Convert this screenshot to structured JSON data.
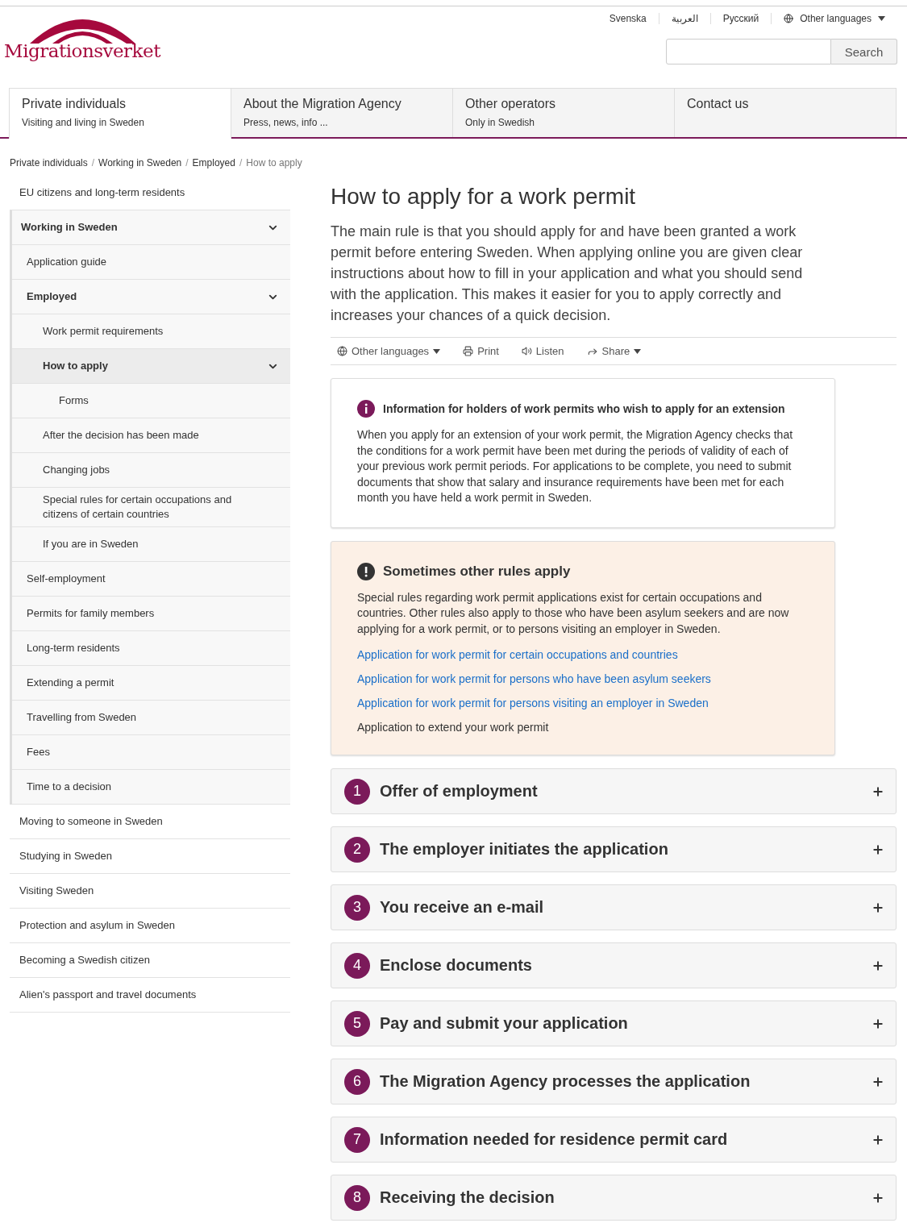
{
  "header": {
    "logo_text": "Migrationsverket",
    "languages": [
      {
        "label": "Svenska",
        "kind": "text"
      },
      {
        "label": "العربية",
        "kind": "text"
      },
      {
        "label": "Русский",
        "kind": "text"
      },
      {
        "label": "Other languages",
        "kind": "menu"
      }
    ],
    "search": {
      "button": "Search"
    }
  },
  "nav": [
    {
      "title": "Private individuals",
      "subtitle": "Visiting and living in Sweden",
      "selected": true
    },
    {
      "title": "About the Migration Agency",
      "subtitle": "Press, news, info ...",
      "selected": false
    },
    {
      "title": "Other operators",
      "subtitle": "Only in Swedish",
      "selected": false
    },
    {
      "title": "Contact us",
      "selected": false
    }
  ],
  "breadcrumb_separator": "/",
  "breadcrumb": [
    {
      "label": "Private individuals",
      "current": false
    },
    {
      "label": "Working in Sweden",
      "current": false
    },
    {
      "label": "Employed",
      "current": false
    },
    {
      "label": "How to apply",
      "current": true
    }
  ],
  "sidebar": {
    "items": [
      {
        "label": "EU citizens and long-term residents",
        "selected": false
      },
      {
        "label": "Working in Sweden",
        "selected": false,
        "expanded": true,
        "children": [
          {
            "label": "Application guide",
            "selected": false
          },
          {
            "label": "Employed",
            "selected": false,
            "expanded": true,
            "children": [
              {
                "label": "Work permit requirements",
                "selected": false
              },
              {
                "label": "How to apply",
                "selected": true,
                "expanded": true,
                "children": [
                  {
                    "label": "Forms",
                    "selected": false
                  }
                ]
              },
              {
                "label": "After the decision has been made",
                "selected": false
              },
              {
                "label": "Changing jobs",
                "selected": false
              },
              {
                "label": "Special rules for certain occupations and citizens of certain countries",
                "selected": false
              },
              {
                "label": "If you are in Sweden",
                "selected": false
              }
            ]
          },
          {
            "label": "Self-employment",
            "selected": false
          },
          {
            "label": "Permits for family members",
            "selected": false
          },
          {
            "label": "Long-term residents",
            "selected": false
          },
          {
            "label": "Extending a permit",
            "selected": false
          },
          {
            "label": "Travelling from Sweden",
            "selected": false
          },
          {
            "label": "Fees",
            "selected": false
          },
          {
            "label": "Time to a decision",
            "selected": false
          }
        ]
      },
      {
        "label": "Moving to someone in Sweden",
        "selected": false
      },
      {
        "label": "Studying in Sweden",
        "selected": false
      },
      {
        "label": "Visiting Sweden",
        "selected": false
      },
      {
        "label": "Protection and asylum in Sweden",
        "selected": false
      },
      {
        "label": "Becoming a Swedish citizen",
        "selected": false
      },
      {
        "label": "Alien's passport and travel documents",
        "selected": false
      }
    ]
  },
  "main": {
    "title": "How to apply for a work permit",
    "intro": "The main rule is that you should apply for and have been granted a work permit before entering Sweden. When applying online you are given clear instructions about how to fill in your application and what you should send with the application. This makes it easier for you to apply correctly and increases your chances of a quick decision.",
    "toolbar": [
      {
        "kind": "languages",
        "label": "Other languages",
        "dropdown": true
      },
      {
        "kind": "print",
        "label": "Print",
        "dropdown": false
      },
      {
        "kind": "listen",
        "label": "Listen",
        "dropdown": false
      },
      {
        "kind": "share",
        "label": "Share",
        "dropdown": true
      }
    ],
    "notices": [
      {
        "kind": "info",
        "title": "Information for holders of work permits who wish to apply for an extension",
        "body": "When you apply for an extension of your work permit, the Migration Agency checks that the conditions for a work permit have been met during the periods of validity of each of your previous work permit periods. For applications to be complete, you need to submit documents that show that salary and insurance requirements have been met for each month you have held a work permit in Sweden."
      },
      {
        "kind": "warning",
        "title": "Sometimes other rules apply",
        "body": "Special rules regarding work permit applications exist for certain occupations and countries. Other rules also apply to those who have been asylum seekers and are now applying for a work permit, or to persons visiting an employer in Sweden.",
        "links": [
          {
            "text": "Application for work permit for certain occupations and countries",
            "kind": "link"
          },
          {
            "text": "Application for work permit for persons who have been asylum seekers",
            "kind": "link"
          },
          {
            "text": "Application for work permit for persons visiting an employer in Sweden",
            "kind": "link"
          },
          {
            "text": "Application to extend your work permit",
            "kind": "text"
          }
        ]
      }
    ],
    "steps": [
      {
        "number": "1",
        "title": "Offer of employment",
        "expanded": false
      },
      {
        "number": "2",
        "title": "The employer initiates the application",
        "expanded": false
      },
      {
        "number": "3",
        "title": "You receive an e-mail",
        "expanded": false
      },
      {
        "number": "4",
        "title": "Enclose documents",
        "expanded": false
      },
      {
        "number": "5",
        "title": "Pay and submit your application",
        "expanded": false
      },
      {
        "number": "6",
        "title": "The Migration Agency processes the application",
        "expanded": false
      },
      {
        "number": "7",
        "title": "Information needed for residence permit card",
        "expanded": false
      },
      {
        "number": "8",
        "title": "Receiving the decision",
        "expanded": false
      }
    ]
  }
}
